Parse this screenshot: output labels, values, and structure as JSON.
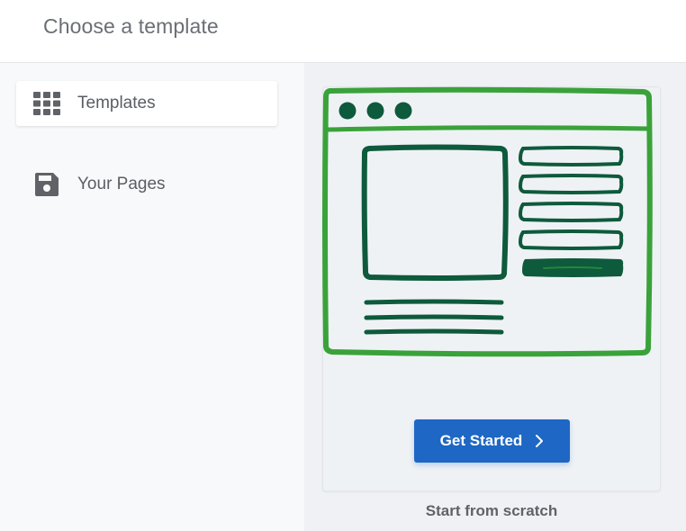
{
  "header": {
    "title": "Choose a template"
  },
  "sidebar": {
    "items": [
      {
        "label": "Templates",
        "icon": "grid-icon",
        "active": true
      },
      {
        "label": "Your Pages",
        "icon": "save-icon",
        "active": false
      }
    ]
  },
  "template_card": {
    "button_label": "Get Started",
    "caption": "Start from scratch",
    "illustration": "blank-page-sketch-icon"
  },
  "colors": {
    "button": "#1e67c4",
    "sketch_frame": "#3aa23a",
    "sketch_content": "#0e5a3c",
    "sidebar_bg": "#f8f9fb",
    "main_bg": "#eff1f4"
  }
}
